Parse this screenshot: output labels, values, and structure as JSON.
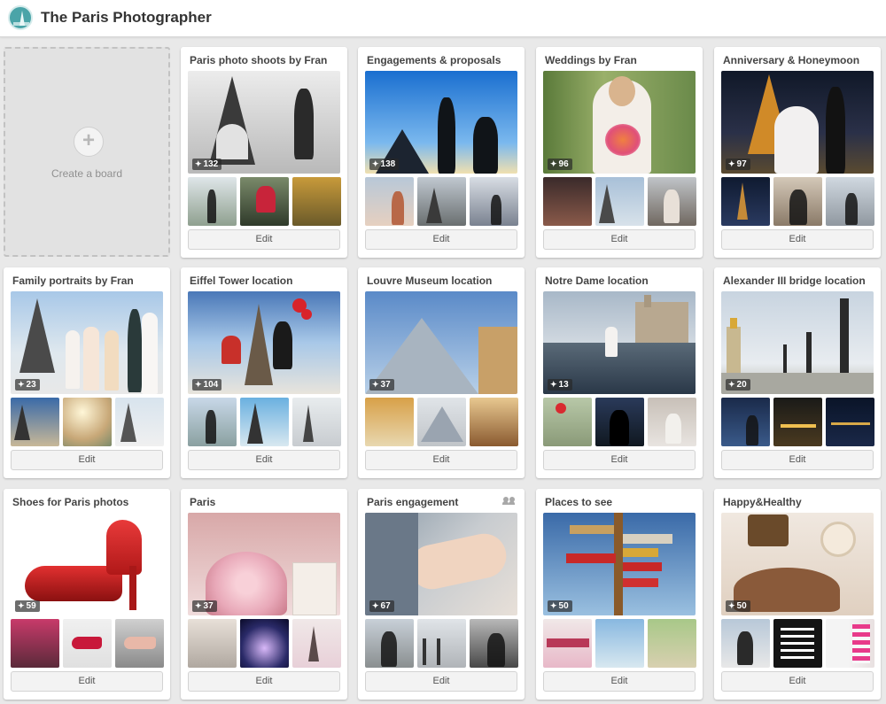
{
  "header": {
    "site_title": "The Paris Photographer",
    "logo_icon": "eiffel-logo-icon"
  },
  "create_board": {
    "label": "Create a board",
    "icon": "plus-icon"
  },
  "boards": [
    {
      "title": "Paris photo shoots by Fran",
      "pins": "132",
      "edit_label": "Edit"
    },
    {
      "title": "Engagements & proposals",
      "pins": "138",
      "edit_label": "Edit"
    },
    {
      "title": "Weddings by Fran",
      "pins": "96",
      "edit_label": "Edit"
    },
    {
      "title": "Anniversary & Honeymoon",
      "pins": "97",
      "edit_label": "Edit"
    },
    {
      "title": "Family portraits by Fran",
      "pins": "23",
      "edit_label": "Edit"
    },
    {
      "title": "Eiffel Tower location",
      "pins": "104",
      "edit_label": "Edit"
    },
    {
      "title": "Louvre Museum location",
      "pins": "37",
      "edit_label": "Edit"
    },
    {
      "title": "Notre Dame location",
      "pins": "13",
      "edit_label": "Edit"
    },
    {
      "title": "Alexander III bridge location",
      "pins": "20",
      "edit_label": "Edit"
    },
    {
      "title": "Shoes for Paris photos",
      "pins": "59",
      "edit_label": "Edit"
    },
    {
      "title": "Paris",
      "pins": "37",
      "edit_label": "Edit"
    },
    {
      "title": "Paris engagement",
      "pins": "67",
      "edit_label": "Edit",
      "collaborative": true
    },
    {
      "title": "Places to see",
      "pins": "50",
      "edit_label": "Edit"
    },
    {
      "title": "Happy&Healthy",
      "pins": "50",
      "edit_label": "Edit"
    }
  ]
}
